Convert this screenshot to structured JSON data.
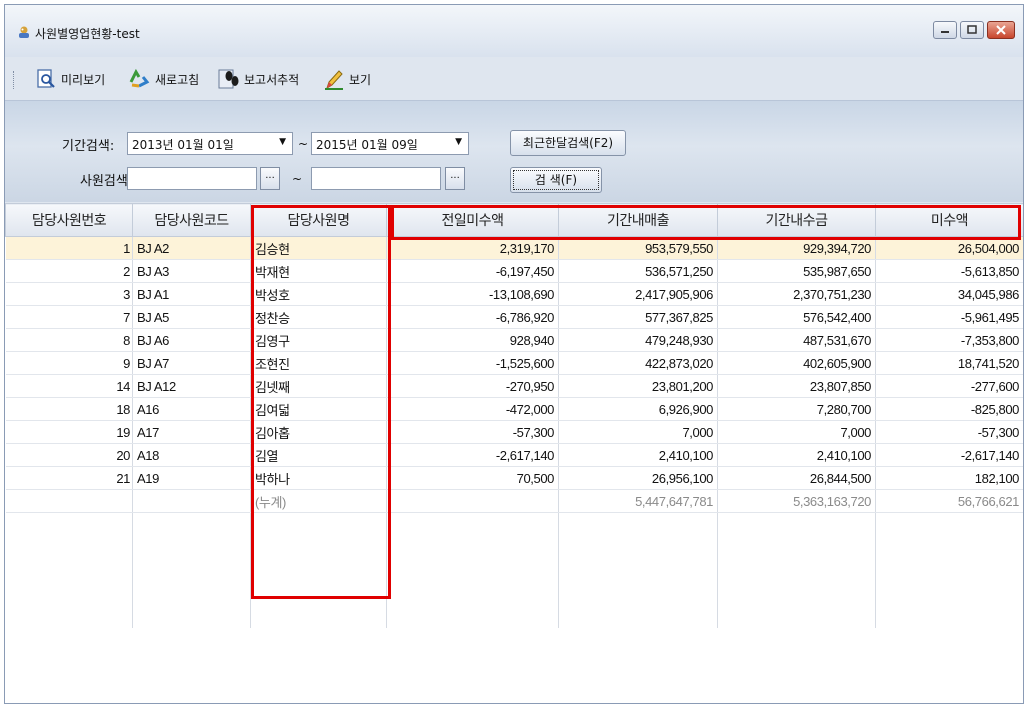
{
  "window": {
    "title": "사원별영업현황-test"
  },
  "toolbar": {
    "preview": "미리보기",
    "refresh": "새로고침",
    "report_trace": "보고서추적",
    "view": "보기"
  },
  "search": {
    "period_label": "기간검색:",
    "period_from": "2013년 01월 01일",
    "period_to": "2015년 01월 09일",
    "tilde": "~",
    "recent_month_button": "최근한달검색(F2)",
    "employee_label": "사원검색:",
    "employee_from": "",
    "employee_to": "",
    "dots": "...",
    "search_button": "검 색(F)"
  },
  "grid": {
    "headers": [
      "담당사원번호",
      "담당사원코드",
      "담당사원명",
      "전일미수액",
      "기간내매출",
      "기간내수금",
      "미수액"
    ],
    "rows": [
      [
        "1",
        "BJ A2",
        "김승현",
        "2,319,170",
        "953,579,550",
        "929,394,720",
        "26,504,000"
      ],
      [
        "2",
        "BJ A3",
        "박재현",
        "-6,197,450",
        "536,571,250",
        "535,987,650",
        "-5,613,850"
      ],
      [
        "3",
        "BJ A1",
        "박성호",
        "-13,108,690",
        "2,417,905,906",
        "2,370,751,230",
        "34,045,986"
      ],
      [
        "7",
        "BJ A5",
        "정찬승",
        "-6,786,920",
        "577,367,825",
        "576,542,400",
        "-5,961,495"
      ],
      [
        "8",
        "BJ A6",
        "김영구",
        "928,940",
        "479,248,930",
        "487,531,670",
        "-7,353,800"
      ],
      [
        "9",
        "BJ A7",
        "조현진",
        "-1,525,600",
        "422,873,020",
        "402,605,900",
        "18,741,520"
      ],
      [
        "14",
        "BJ A12",
        "김넷째",
        "-270,950",
        "23,801,200",
        "23,807,850",
        "-277,600"
      ],
      [
        "18",
        " A16",
        "김여덟",
        "-472,000",
        "6,926,900",
        "7,280,700",
        "-825,800"
      ],
      [
        "19",
        "A17",
        "김아홉",
        "-57,300",
        "7,000",
        "7,000",
        "-57,300"
      ],
      [
        "20",
        "A18",
        "김열",
        "-2,617,140",
        "2,410,100",
        "2,410,100",
        "-2,617,140"
      ],
      [
        "21",
        " A19",
        "박하나",
        "70,500",
        "26,956,100",
        "26,844,500",
        "182,100"
      ]
    ],
    "total": [
      "",
      "",
      "(누계)",
      "",
      "5,447,647,781",
      "5,363,163,720",
      "56,766,621"
    ]
  },
  "colors": {
    "highlight": "#e00000",
    "selected_row": "#fdf3d9"
  },
  "icons": [
    "app-icon",
    "preview-icon",
    "refresh-icon",
    "report-trace-icon",
    "view-icon"
  ]
}
